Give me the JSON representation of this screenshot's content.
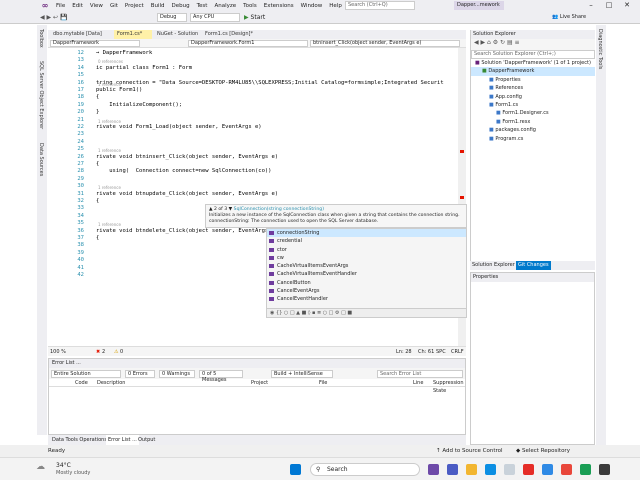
{
  "menu": {
    "items": [
      "File",
      "Edit",
      "View",
      "Git",
      "Project",
      "Build",
      "Debug",
      "Test",
      "Analyze",
      "Tools",
      "Extensions",
      "Window",
      "Help"
    ],
    "search_placeholder": "Search (Ctrl+Q)",
    "window_title": "Dapper...mework"
  },
  "toolbar": {
    "config": "Debug",
    "platform": "Any CPU",
    "start_label": "Start",
    "live_share": "Live Share"
  },
  "left_tabs": [
    "Toolbox",
    "SQL Server Object Explorer",
    "Data Sources"
  ],
  "right_tabs": [
    "Diagnostic Tools"
  ],
  "doc_tabs": [
    {
      "label": "dbo.mytable [Data]",
      "active": false
    },
    {
      "label": "Form1.cs*",
      "active": true
    },
    {
      "label": "NuGet - Solution",
      "active": false
    },
    {
      "label": "Form1.cs [Design]*",
      "active": false
    }
  ],
  "navbar": {
    "project": "DapperFramework",
    "class": "DapperFramework.Form1",
    "member": "btninsert_Click(object sender, EventArgs e)"
  },
  "editor": {
    "lines": [
      {
        "n": "12",
        "text": "→ DapperFramework",
        "ref": ""
      },
      {
        "n": "13",
        "text": "",
        "ref": "0 references"
      },
      {
        "n": "14",
        "text": "ic partial class Form1 : Form",
        "ref": ""
      },
      {
        "n": "15",
        "text": "",
        "ref": ""
      },
      {
        "n": "16",
        "text": "tring connection = \"Data Source=DESKTOP-RM4LU85\\\\SQLEXPRESS;Initial Catalog=formsimple;Integrated Securit",
        "ref": "1 reference"
      },
      {
        "n": "17",
        "text": "public Form1()",
        "ref": ""
      },
      {
        "n": "18",
        "text": "{",
        "ref": ""
      },
      {
        "n": "19",
        "text": "    InitializeComponent();",
        "ref": ""
      },
      {
        "n": "20",
        "text": "}",
        "ref": ""
      },
      {
        "n": "21",
        "text": "",
        "ref": "1 reference"
      },
      {
        "n": "22",
        "text": "rivate void Form1_Load(object sender, EventArgs e)",
        "ref": ""
      },
      {
        "n": "23",
        "text": "",
        "ref": ""
      },
      {
        "n": "24",
        "text": "",
        "ref": ""
      },
      {
        "n": "25",
        "text": "",
        "ref": "1 reference"
      },
      {
        "n": "26",
        "text": "rivate void btninsert_Click(object sender, EventArgs e)",
        "ref": ""
      },
      {
        "n": "27",
        "text": "{",
        "ref": ""
      },
      {
        "n": "28",
        "text": "    using(  Connection connect=new SqlConnection(co))",
        "ref": ""
      },
      {
        "n": "29",
        "text": "",
        "ref": ""
      },
      {
        "n": "30",
        "text": "",
        "ref": "1 reference"
      },
      {
        "n": "31",
        "text": "rivate void btnupdate_Click(object sender, EventArgs e)",
        "ref": ""
      },
      {
        "n": "32",
        "text": "{",
        "ref": ""
      },
      {
        "n": "33",
        "text": "",
        "ref": ""
      },
      {
        "n": "34",
        "text": "",
        "ref": ""
      },
      {
        "n": "35",
        "text": "",
        "ref": "1 reference"
      },
      {
        "n": "36",
        "text": "rivate void btndelete_Click(object sender, EventArgs e)",
        "ref": ""
      },
      {
        "n": "37",
        "text": "{",
        "ref": ""
      },
      {
        "n": "38",
        "text": "",
        "ref": ""
      },
      {
        "n": "39",
        "text": "",
        "ref": ""
      },
      {
        "n": "40",
        "text": "",
        "ref": ""
      },
      {
        "n": "41",
        "text": "",
        "ref": ""
      },
      {
        "n": "42",
        "text": "",
        "ref": ""
      }
    ]
  },
  "tooltip": {
    "counter": "▲ 2 of 3 ▼",
    "signature": "SqlConnection(string connectionString)",
    "desc": "Initializes a new instance of the SqlConnection class when given a string that contains the connection string.",
    "param": "connectionString: The connection used to open the SQL Server database."
  },
  "intellisense": {
    "items": [
      {
        "label": "connectionString",
        "selected": true
      },
      {
        "label": "credential",
        "selected": false
      },
      {
        "label": "ctor",
        "selected": false
      },
      {
        "label": "cw",
        "selected": false
      },
      {
        "label": "CacheVirtualItemsEventArgs",
        "selected": false
      },
      {
        "label": "CacheVirtualItemsEventHandler",
        "selected": false
      },
      {
        "label": "CancelButton",
        "selected": false
      },
      {
        "label": "CancelEventArgs",
        "selected": false
      },
      {
        "label": "CancelEventHandler",
        "selected": false
      }
    ]
  },
  "editor_status": {
    "zoom": "100 %",
    "errors": "2",
    "warnings": "0",
    "position": "Ln: 28",
    "column": "Ch: 61",
    "spc": "SPC",
    "crlf": "CRLF"
  },
  "error_list": {
    "title": "Error List ...",
    "scope": "Entire Solution",
    "errors_label": "0 Errors",
    "warnings_label": "0 Warnings",
    "messages_label": "0 of 5 Messages",
    "build_filter": "Build + IntelliSense",
    "search_placeholder": "Search Error List",
    "columns": [
      "Code",
      "Description",
      "Project",
      "File",
      "Line",
      "Suppression State"
    ]
  },
  "bottom_tabs": [
    "Data Tools Operations",
    "Error List ...",
    "Output"
  ],
  "solution_explorer": {
    "title": "Solution Explorer",
    "search_placeholder": "Search Solution Explorer (Ctrl+;)",
    "tree": [
      {
        "label": "Solution 'DapperFramework' (1 of 1 project)",
        "indent": 0,
        "selected": false
      },
      {
        "label": "DapperFramework",
        "indent": 1,
        "selected": true
      },
      {
        "label": "Properties",
        "indent": 2,
        "selected": false
      },
      {
        "label": "References",
        "indent": 2,
        "selected": false
      },
      {
        "label": "App.config",
        "indent": 2,
        "selected": false
      },
      {
        "label": "Form1.cs",
        "indent": 2,
        "selected": false
      },
      {
        "label": "Form1.Designer.cs",
        "indent": 3,
        "selected": false
      },
      {
        "label": "Form1.resx",
        "indent": 3,
        "selected": false
      },
      {
        "label": "packages.config",
        "indent": 2,
        "selected": false
      },
      {
        "label": "Program.cs",
        "indent": 2,
        "selected": false
      }
    ],
    "tabs": [
      "Solution Explorer",
      "Git Changes"
    ]
  },
  "properties": {
    "title": "Properties"
  },
  "status_bar": {
    "ready": "Ready",
    "add_source": "Add to Source Control",
    "select_repo": "Select Repository"
  },
  "taskbar": {
    "weather_temp": "34°C",
    "weather_desc": "Mostly cloudy",
    "search_label": "Search"
  }
}
